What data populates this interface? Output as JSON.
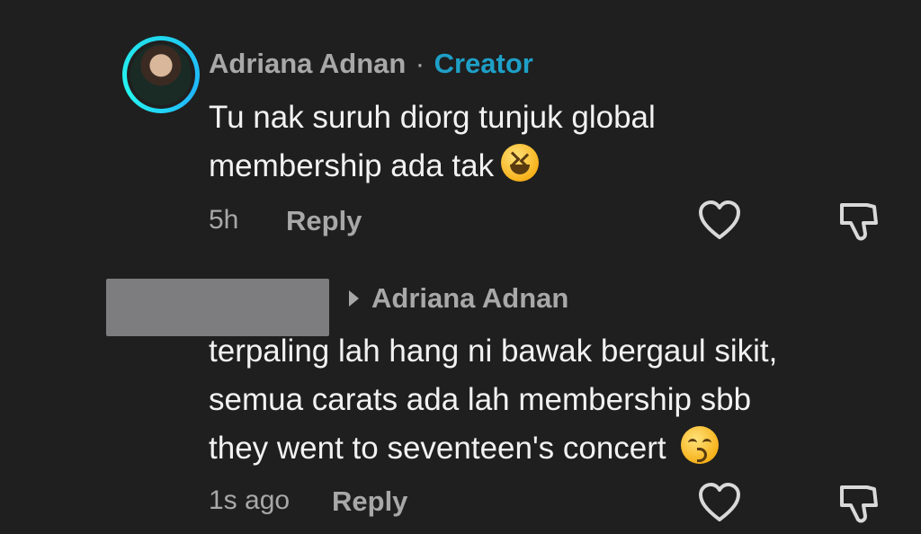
{
  "comment1": {
    "author": "Adriana Adnan",
    "separator": "·",
    "badge": "Creator",
    "text_line1": "Tu nak suruh diorg tunjuk global",
    "text_line2": "membership ada tak",
    "emoji": "grinning-squinting-face",
    "time": "5h",
    "reply_label": "Reply"
  },
  "comment2": {
    "reply_to": "Adriana Adnan",
    "text_line1": "terpaling lah hang ni bawak bergaul sikit,",
    "text_line2": "semua carats ada lah membership sbb",
    "text_line3": "they went to seventeen's concert",
    "emoji": "kissing-face-with-smiling-eyes",
    "time": "1s ago",
    "reply_label": "Reply"
  },
  "icons": {
    "like": "heart-outline-icon",
    "dislike": "thumbs-down-outline-icon",
    "reply_arrow": "triangle-right-icon"
  },
  "colors": {
    "background": "#1f1f1f",
    "creator_badge": "#1ea0c8",
    "avatar_ring": "#20d5ec",
    "muted_text": "#a8a8a8"
  }
}
